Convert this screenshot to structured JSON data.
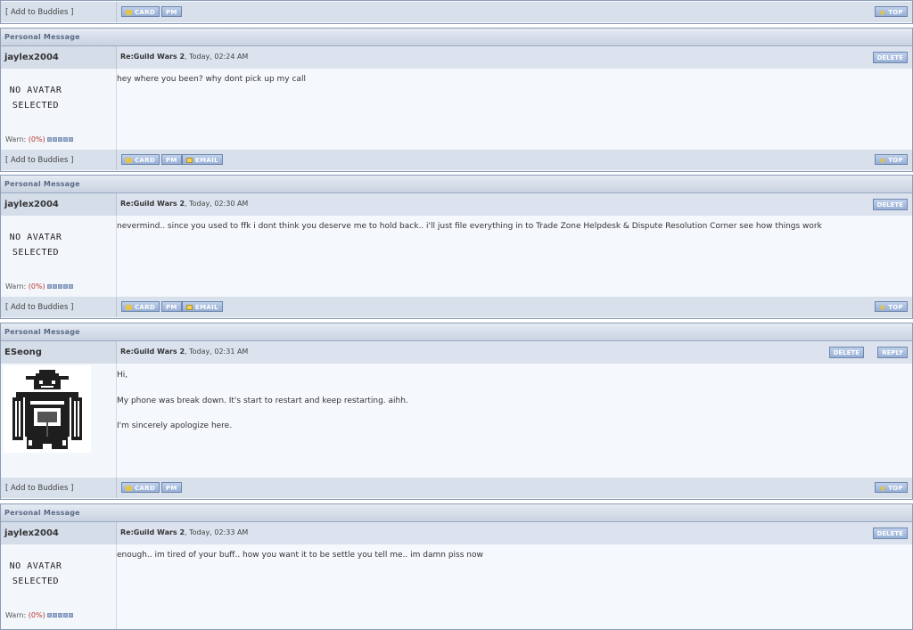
{
  "common": {
    "add_to_buddies": "[ Add to Buddies ]",
    "card": "CARD",
    "pm": "PM",
    "email": "EMAIL",
    "top": "TOP",
    "delete": "DELETE",
    "reply": "REPLY",
    "table_caption": "Personal Message",
    "no_avatar_line1": "NO AVATAR",
    "no_avatar_line2": "SELECTED",
    "warn_label": "Warn:",
    "warn_pct": "(0%)"
  },
  "posts": [
    {
      "author": "jaylex2004",
      "subject": "Re:Guild Wars 2",
      "date": ", Today, 02:24 AM",
      "lines": [
        "hey where you been? why dont pick up my call"
      ]
    },
    {
      "author": "jaylex2004",
      "subject": "Re:Guild Wars 2",
      "date": ", Today, 02:30 AM",
      "lines": [
        "nevermind.. since you used to ffk i dont think you deserve me to hold back.. i'll just file everything in to Trade Zone Helpdesk & Dispute Resolution Corner see how things work"
      ]
    },
    {
      "author": "ESeong",
      "subject": "Re:Guild Wars 2",
      "date": ", Today, 02:31 AM",
      "lines": [
        "Hi,",
        "My phone was break down. It's start to restart and keep restarting. aihh.",
        "I'm sincerely apologize here."
      ]
    },
    {
      "author": "jaylex2004",
      "subject": "Re:Guild Wars 2",
      "date": ", Today, 02:33 AM",
      "lines": [
        "enough.. im tired of your buff.. how you want it to be settle you tell me.. im damn piss now"
      ]
    }
  ]
}
